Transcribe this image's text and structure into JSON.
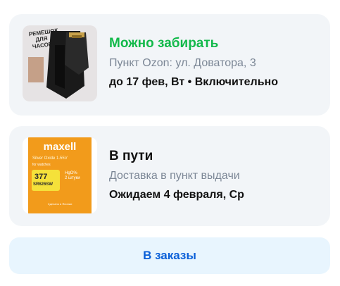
{
  "orders": [
    {
      "status": "Можно забирать",
      "location": "Пункт Ozon: ул. Доватора, 3",
      "deadline": "до 17 фев, Вт • Включительно",
      "image": {
        "type": "watch-strap",
        "label": "РЕМЕШОК ДЛЯ ЧАСОВ"
      }
    },
    {
      "status": "В пути",
      "location": "Доставка в пункт выдачи",
      "deadline": "Ожидаем 4 февраля, Ср",
      "image": {
        "type": "battery-pack",
        "brand": "maxell",
        "silver_oxide": "Silver Oxide 1.55V",
        "for_watches": "for watches",
        "number": "377",
        "model": "SR626SW",
        "hg_free": "HgO%",
        "count": "2 штуки",
        "footer": "Сделано в Японии"
      }
    }
  ],
  "orders_button": "В заказы",
  "colors": {
    "status_ready": "#12b94a",
    "button_text": "#0a5fd8",
    "button_bg": "#e8f5fe",
    "card_bg": "#f2f5f8"
  }
}
